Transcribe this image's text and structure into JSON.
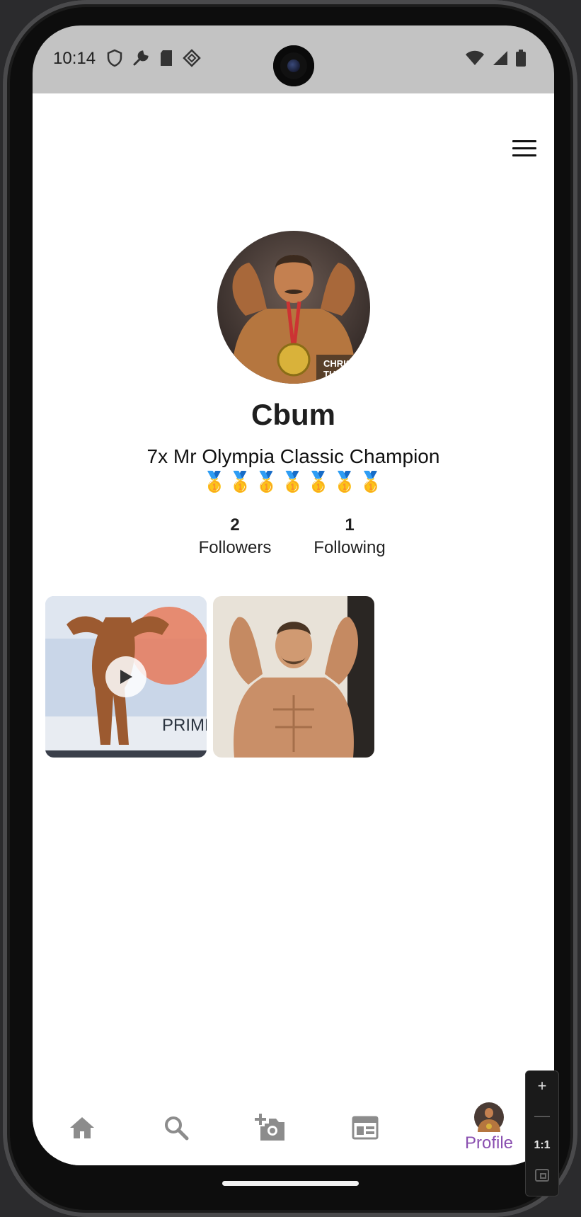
{
  "status_bar": {
    "time": "10:14",
    "left_icons": [
      "shield-icon",
      "wrench-icon",
      "sd-card-icon",
      "diamond-icon"
    ],
    "right_icons": [
      "wifi-icon",
      "signal-icon",
      "battery-icon"
    ]
  },
  "profile": {
    "name": "Cbum",
    "bio": "7x Mr Olympia Classic Champion",
    "medals": "🥇🥇🥇🥇🥇🥇🥇",
    "followers_count": "2",
    "followers_label": "Followers",
    "following_count": "1",
    "following_label": "Following"
  },
  "posts": [
    {
      "kind": "video"
    },
    {
      "kind": "photo"
    }
  ],
  "bottom_nav": {
    "items": [
      {
        "icon": "home-icon"
      },
      {
        "icon": "search-icon"
      },
      {
        "icon": "add-photo-icon"
      },
      {
        "icon": "feed-icon"
      },
      {
        "icon": "avatar",
        "label": "Profile"
      }
    ],
    "active_color": "#8a4fb0",
    "inactive_color": "#8c8c8c"
  },
  "zoom_controls": {
    "zoom_in": "+",
    "zoom_out": "—",
    "reset": "1:1"
  }
}
